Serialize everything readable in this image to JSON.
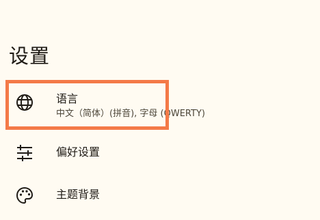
{
  "page": {
    "title": "设置"
  },
  "items": [
    {
      "title": "语言",
      "summary": "中文（简体）(拼音), 字母 (QWERTY)",
      "icon": "globe-icon"
    },
    {
      "title": "偏好设置",
      "icon": "sliders-icon"
    },
    {
      "title": "主题背景",
      "icon": "palette-icon"
    }
  ],
  "colors": {
    "background": "#FFFBF2",
    "highlight": "#F47A48",
    "text": "#1f1b16",
    "subtext": "#4c4639"
  }
}
